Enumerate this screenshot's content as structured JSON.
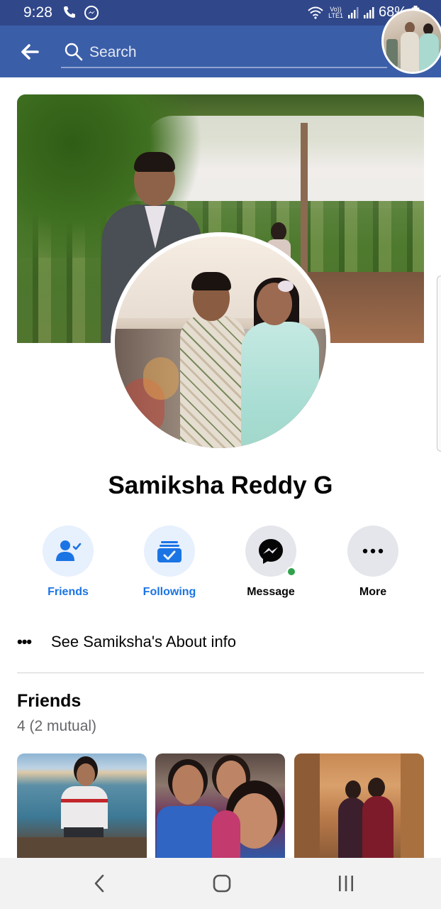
{
  "status_bar": {
    "time": "9:28",
    "volte_top": "Vo))",
    "volte_bottom": "LTE1",
    "battery_percent": "68%",
    "left_icons": [
      "phone-icon",
      "messenger-icon"
    ],
    "right_icons": [
      "wifi-icon",
      "signal-icon",
      "signal-icon",
      "battery-icon"
    ]
  },
  "app_bar": {
    "back_icon": "back-arrow-icon",
    "search_placeholder": "Search",
    "bg_color": "#3b5ea8"
  },
  "profile": {
    "name": "Samiksha Reddy G"
  },
  "actions": [
    {
      "label": "Friends",
      "icon": "friends-icon",
      "active": true
    },
    {
      "label": "Following",
      "icon": "following-icon",
      "active": true
    },
    {
      "label": "Message",
      "icon": "messenger-icon",
      "active": false,
      "online": true
    },
    {
      "label": "More",
      "icon": "more-icon",
      "active": false
    }
  ],
  "about": {
    "dots": "•••",
    "text": "See Samiksha's About info"
  },
  "friends": {
    "title": "Friends",
    "count": "4 (2 mutual)"
  },
  "colors": {
    "accent": "#1b74e4",
    "status_bar": "#30478a",
    "online": "#31a24c"
  }
}
